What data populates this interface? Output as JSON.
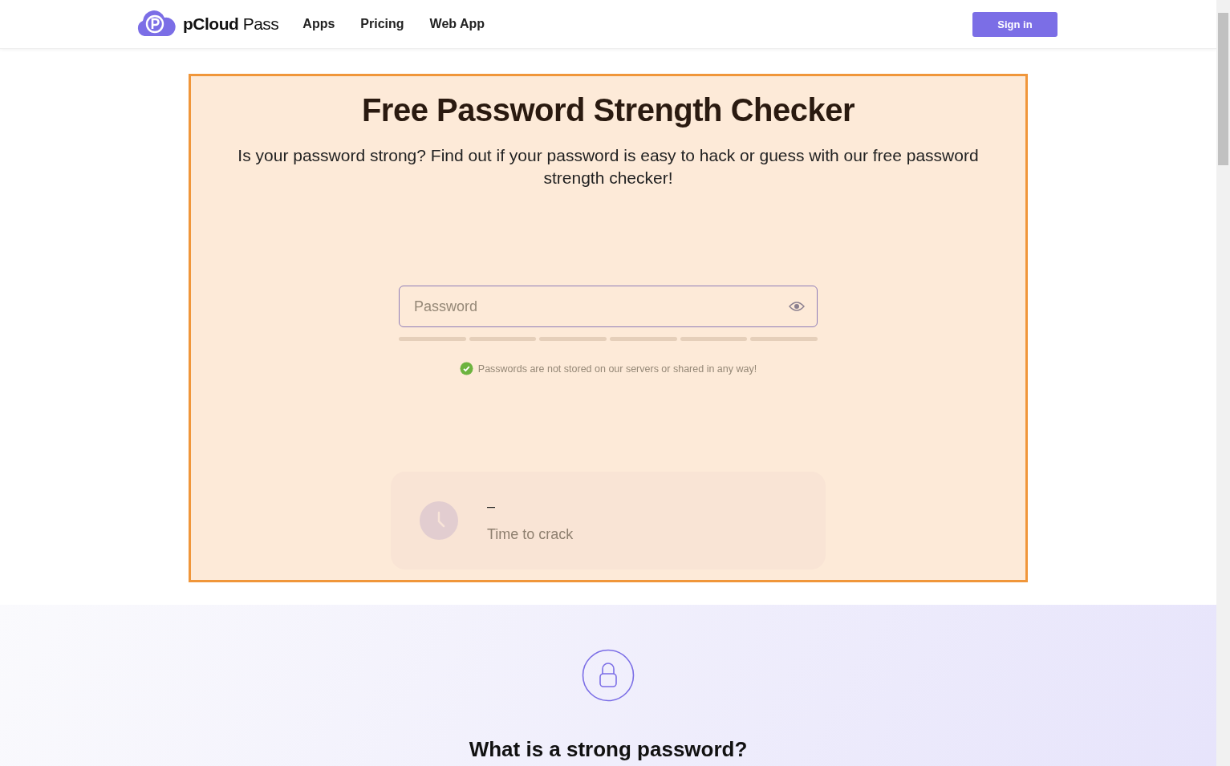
{
  "header": {
    "logo_text": "pCloud",
    "logo_suffix": "Pass",
    "nav": [
      {
        "label": "Apps"
      },
      {
        "label": "Pricing"
      },
      {
        "label": "Web App"
      }
    ],
    "sign_in": "Sign in"
  },
  "hero": {
    "title": "Free Password Strength Checker",
    "subtitle": "Is your password strong? Find out if your password is easy to hack or guess with our free password strength checker!",
    "password_field": {
      "placeholder": "Password"
    },
    "privacy_note": "Passwords are not stored on our servers or shared in any way!",
    "result": {
      "value": "–",
      "label": "Time to crack"
    }
  },
  "info": {
    "heading": "What is a strong password?"
  }
}
